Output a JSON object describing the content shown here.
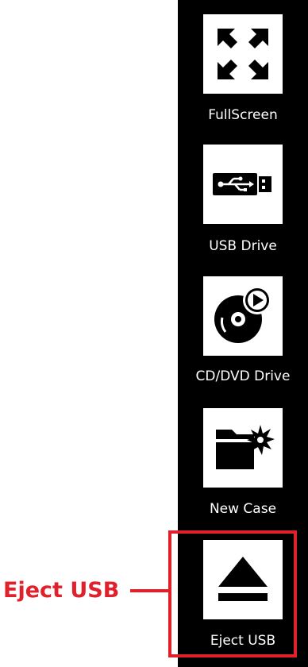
{
  "sidebar": {
    "items": [
      {
        "label": "FullScreen",
        "icon": "fullscreen-expand-icon"
      },
      {
        "label": "USB Drive",
        "icon": "usb-drive-icon"
      },
      {
        "label": "CD/DVD Drive",
        "icon": "cd-dvd-play-icon"
      },
      {
        "label": "New Case",
        "icon": "new-folder-icon"
      },
      {
        "label": "Eject USB",
        "icon": "eject-icon"
      }
    ]
  },
  "annotation": {
    "callout_label": "Eject USB",
    "color": "#e0202a"
  },
  "colors": {
    "sidebar_background": "#000000",
    "tile_background": "#ffffff",
    "icon_color": "#000000",
    "label_color": "#ffffff"
  }
}
